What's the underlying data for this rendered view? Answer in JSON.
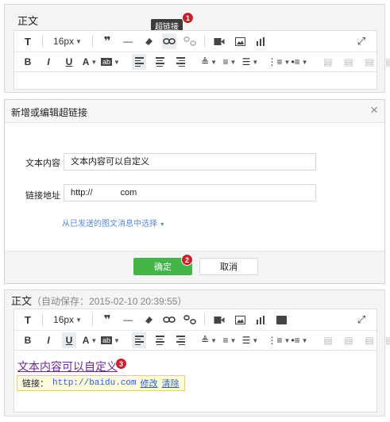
{
  "top_editor": {
    "label": "正文",
    "tooltip": "超链接",
    "badge": "1",
    "font_size": "16px",
    "row1_icons": [
      "text-format-icon",
      "font-size-select",
      "quote-icon",
      "horizontal-rule-icon",
      "eraser-icon",
      "link-icon",
      "unlink-icon",
      "video-icon",
      "image-icon",
      "chart-icon"
    ],
    "row2_labels": {
      "bold": "B",
      "italic": "I",
      "underline": "U",
      "font_color": "A",
      "bg_color": "ab"
    }
  },
  "dialog": {
    "title": "新增或编辑超链接",
    "close": "×",
    "text_label": "文本内容",
    "text_value": "文本内容可以自定义",
    "url_label": "链接地址",
    "url_prefix": "http://",
    "url_suffix": "com",
    "select_link": "从已发送的图文消息中选择",
    "confirm": "确定",
    "cancel": "取消",
    "badge": "2"
  },
  "bottom_editor": {
    "label": "正文",
    "autosave": "（自动保存：2015-02-10 20:39:55）",
    "font_size": "16px",
    "link_text": "文本内容可以自定义",
    "badge": "3",
    "popup_label": "链接：",
    "popup_url": "http://baidu.com",
    "popup_edit": "修改",
    "popup_remove": "清除"
  },
  "colors": {
    "confirm_green": "#44b549",
    "link_purple": "#6a2a8c",
    "badge_red": "#c7212b"
  }
}
